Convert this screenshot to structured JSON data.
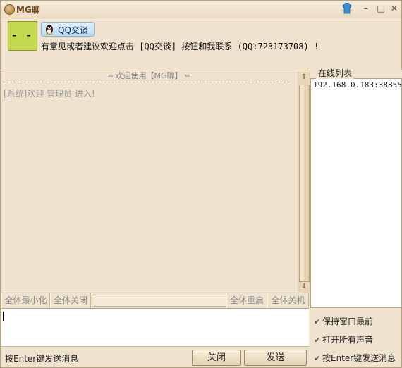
{
  "window": {
    "title": "MG聊"
  },
  "header": {
    "avatar_text": "- -",
    "qq_button_label": "QQ交谈",
    "notice": "有意见或者建议欢迎点击 [QQ交谈] 按钮和我联系 (QQ:723173708) !"
  },
  "chat": {
    "header": "═ 欢迎使用【MG聊】 ═",
    "messages": [
      "[系统]欢迎 管理员 进入!"
    ]
  },
  "online": {
    "title": "在线列表",
    "items": [
      "192.168.0.183:38855"
    ]
  },
  "toolbar": {
    "minimize_all": "全体最小化",
    "close_all": "全体关闭",
    "restart_all": "全体重启",
    "shutdown_all": "全体关机"
  },
  "options": {
    "keep_top": "保持窗口最前",
    "sound_on": "打开所有声音",
    "enter_send": "按Enter键发送消息"
  },
  "bottom": {
    "hint": "按Enter键发送消息",
    "close_label": "关闭",
    "send_label": "发送"
  },
  "colors": {
    "avatar": "#c3d84c",
    "qq_button": "#b9dcf4",
    "window_bg": "#efe3cf"
  },
  "icons": [
    "app-icon",
    "skin-icon",
    "minimize-icon",
    "maximize-icon",
    "close-icon",
    "qq-penguin-icon",
    "scroll-up-icon",
    "scroll-down-icon",
    "check-icon"
  ]
}
